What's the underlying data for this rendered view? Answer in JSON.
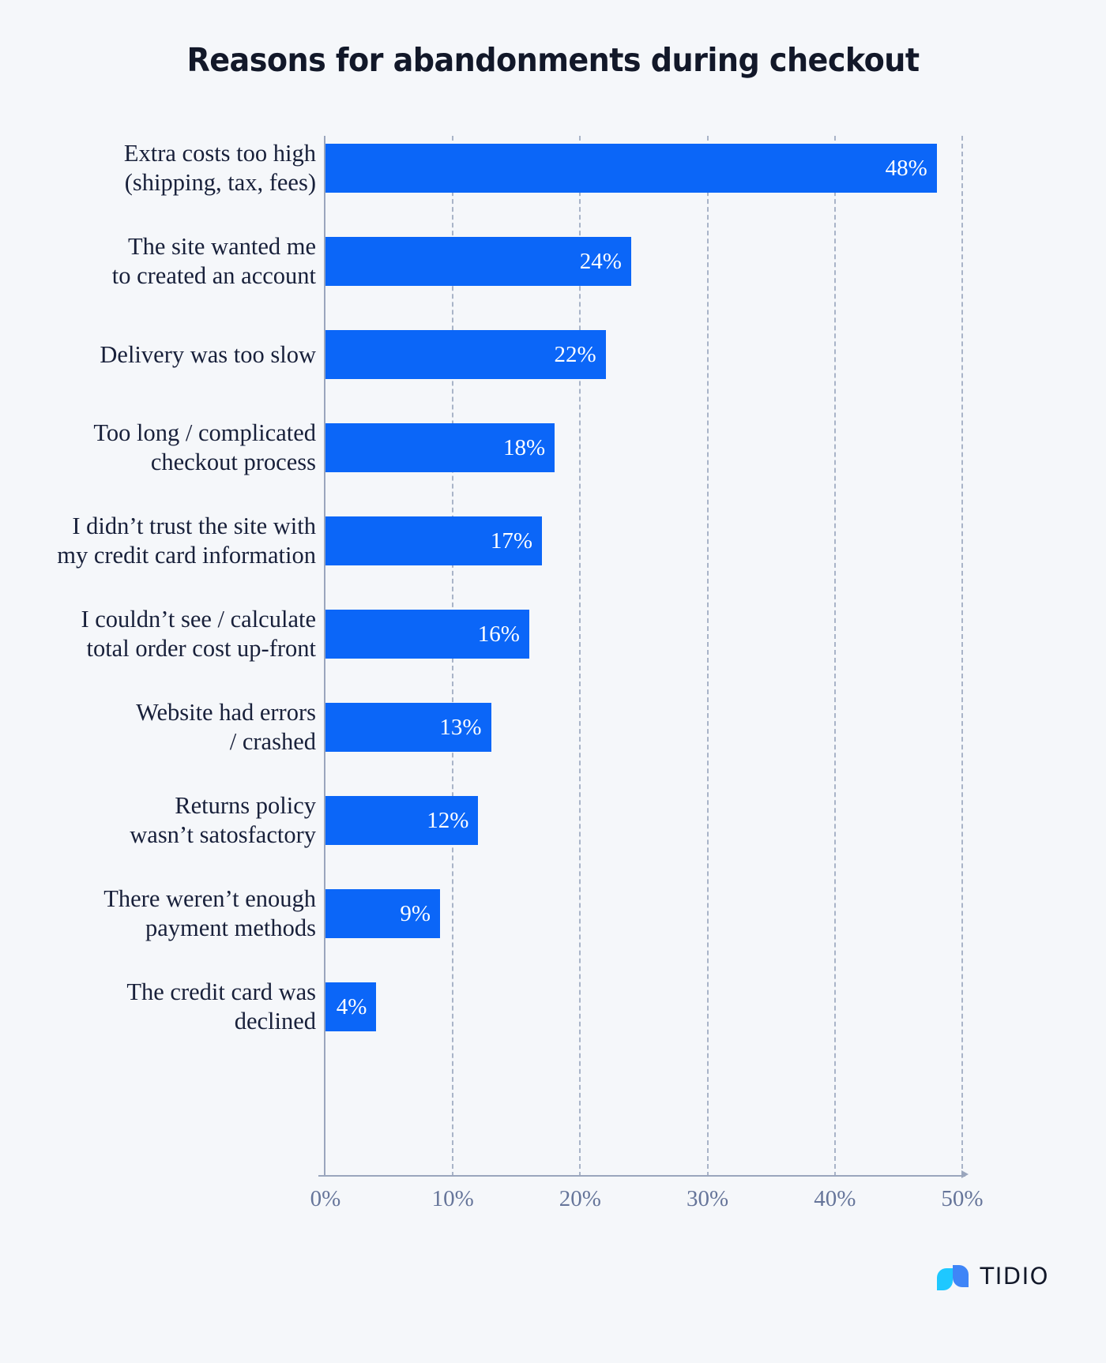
{
  "chart_data": {
    "type": "bar",
    "orientation": "horizontal",
    "title": "Reasons for abandonments during checkout",
    "xlabel": "",
    "ylabel": "",
    "xlim": [
      0,
      50
    ],
    "grid": true,
    "gridlines_axis": "x",
    "legend": "none",
    "xticks": [
      "0%",
      "10%",
      "20%",
      "30%",
      "40%",
      "50%"
    ],
    "xtick_values": [
      0,
      10,
      20,
      30,
      40,
      50
    ],
    "categories": [
      "Extra costs too high\n(shipping, tax, fees)",
      "The site wanted me\nto created an account",
      "Delivery was too slow",
      "Too long / complicated\ncheckout process",
      "I didn’t trust the site with\nmy credit card information",
      "I couldn’t see / calculate\ntotal order cost up-front",
      "Website had errors\n/ crashed",
      "Returns policy\nwasn’t satosfactory",
      "There weren’t enough\npayment methods",
      "The credit card was\ndeclined"
    ],
    "values": [
      48,
      24,
      22,
      18,
      17,
      16,
      13,
      12,
      9,
      4
    ],
    "value_labels": [
      "48%",
      "24%",
      "22%",
      "18%",
      "17%",
      "16%",
      "13%",
      "12%",
      "9%",
      "4%"
    ],
    "bar_color": "#0b66f8",
    "value_label_color": "#ffffff",
    "background_color": "#f5f7fa",
    "axis_color": "#9aa6bd",
    "tick_text_color": "#66759a",
    "category_text_color": "#18203a"
  },
  "footer": {
    "logo_text": "TIDIO",
    "logo_color_primary": "#2f7bf6",
    "logo_color_secondary": "#1ec8ff"
  }
}
